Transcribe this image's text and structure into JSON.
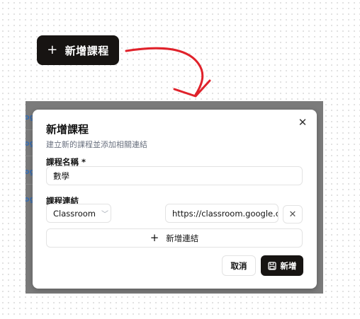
{
  "trigger_button": {
    "label": "新增課程",
    "icon": "plus-icon"
  },
  "backdrop": {
    "fragment_text": "og"
  },
  "dialog": {
    "title": "新增課程",
    "description": "建立新的課程並添加相關連結",
    "close_icon": "close-icon",
    "course_name": {
      "label": "課程名稱 *",
      "value": "數學"
    },
    "course_links": {
      "label": "課程連結",
      "type_select": "Classroom",
      "url_value": "https://classroom.google.co",
      "remove_icon": "close-icon"
    },
    "add_link_button": "新增連結",
    "cancel_button": "取消",
    "submit_button": "新增"
  },
  "colors": {
    "primary_dark": "#171412",
    "arrow_red": "#e0222b",
    "backdrop": "#7b7b7b"
  }
}
